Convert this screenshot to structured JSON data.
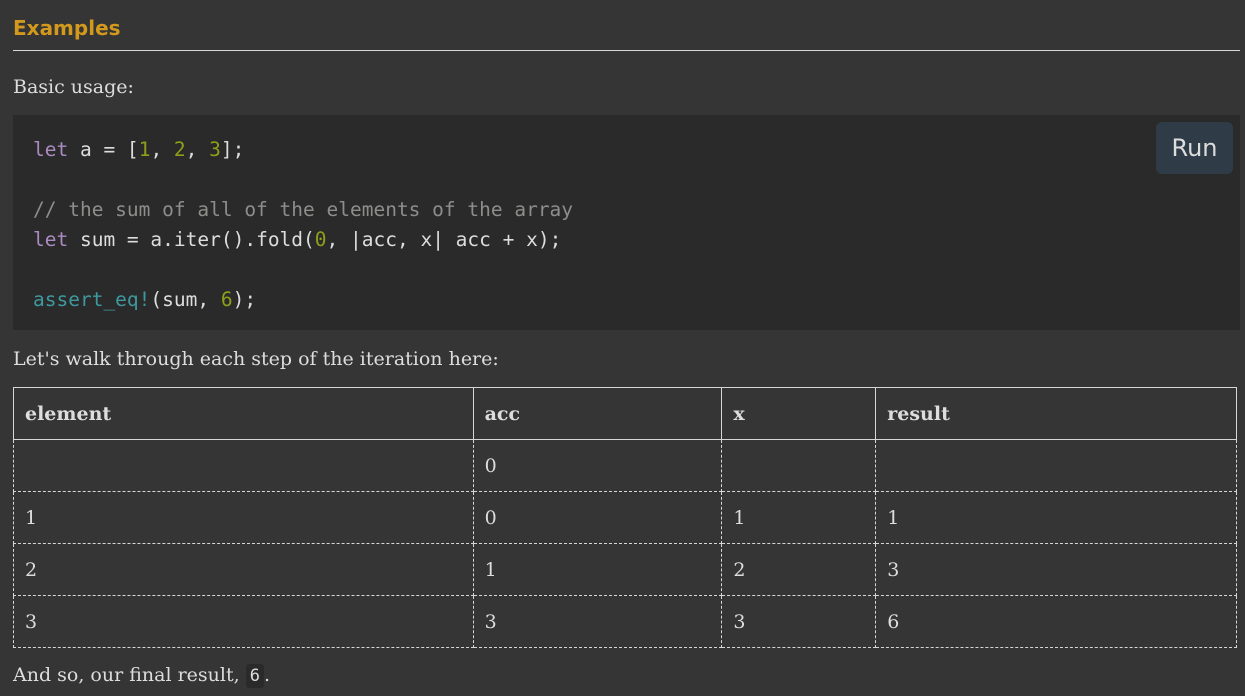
{
  "section": {
    "heading": "Examples"
  },
  "intro": {
    "text": "Basic usage:"
  },
  "code": {
    "line1": {
      "kw": "let",
      "rest_a": " a = [",
      "n1": "1",
      "c1": ", ",
      "n2": "2",
      "c2": ", ",
      "n3": "3",
      "end": "];"
    },
    "comment": "// the sum of all of the elements of the array",
    "line3": {
      "kw": "let",
      "rest_a": " sum = a.iter().fold(",
      "n0": "0",
      "rest_b": ", |acc, x| acc + x);"
    },
    "line5": {
      "macro": "assert_eq!",
      "rest_a": "(sum, ",
      "n6": "6",
      "end": ");"
    },
    "run_label": "Run"
  },
  "walkthrough": {
    "text": "Let's walk through each step of the iteration here:"
  },
  "table": {
    "headers": [
      "element",
      "acc",
      "x",
      "result"
    ],
    "rows": [
      [
        "",
        "0",
        "",
        ""
      ],
      [
        "1",
        "0",
        "1",
        "1"
      ],
      [
        "2",
        "1",
        "2",
        "3"
      ],
      [
        "3",
        "3",
        "3",
        "6"
      ]
    ]
  },
  "conclusion": {
    "prefix": "And so, our final result, ",
    "value": "6",
    "suffix": "."
  },
  "colors": {
    "background": "#353535",
    "heading": "#d2991d",
    "keyword": "#ab8ac1",
    "number": "#8f9f1a",
    "comment": "#8d8d8b",
    "macro": "#3e999f",
    "run_button": "#2f3b46"
  }
}
